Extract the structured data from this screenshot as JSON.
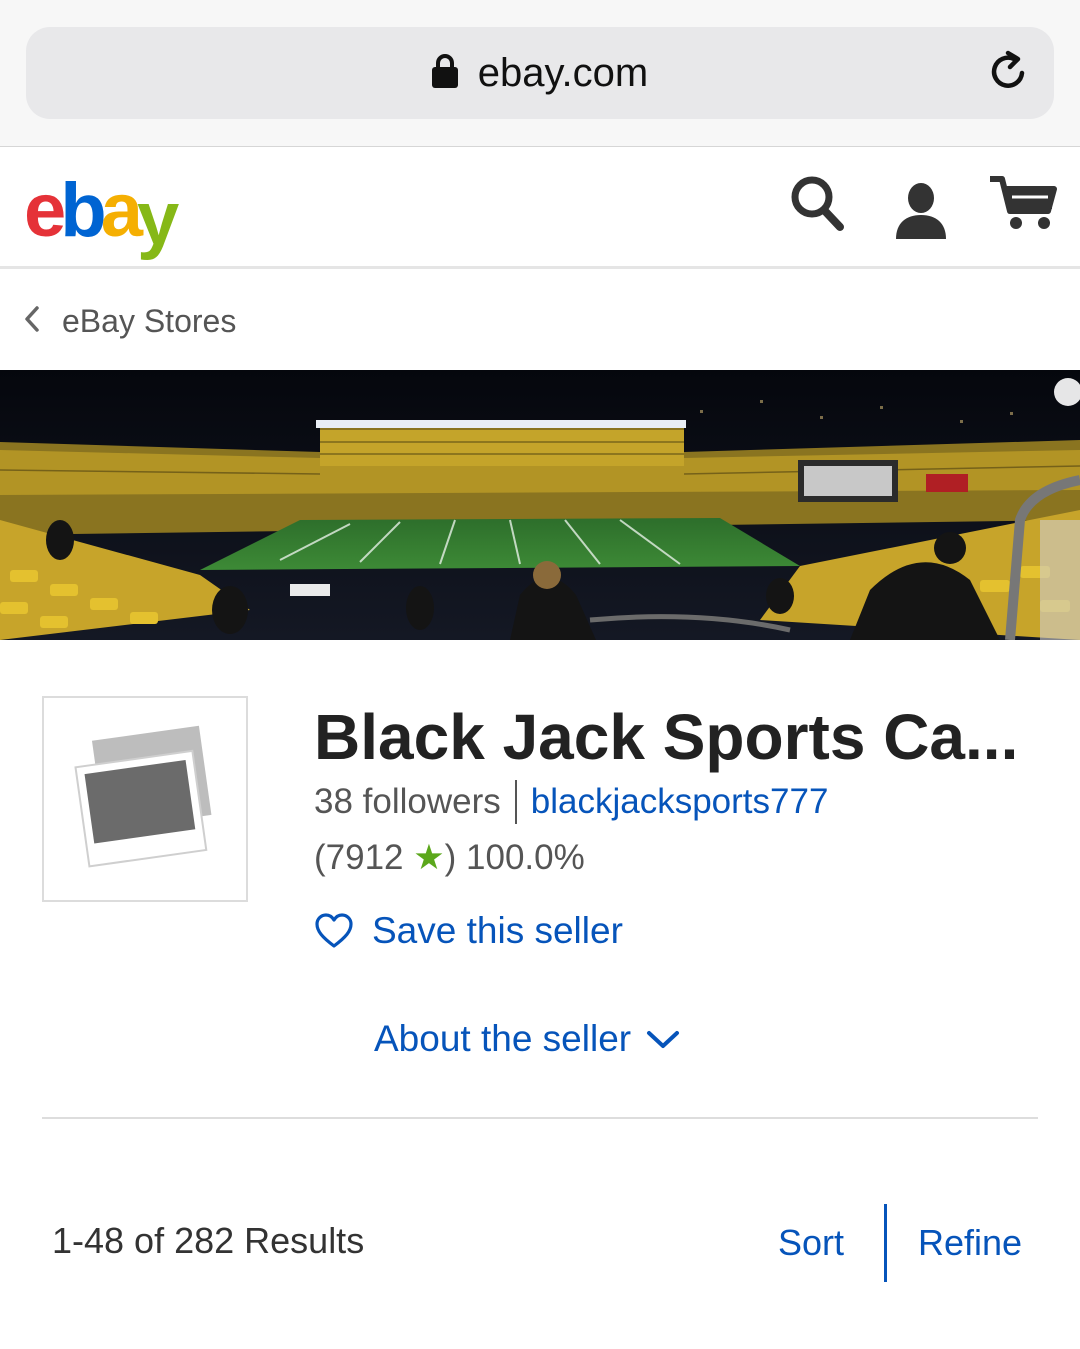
{
  "browser": {
    "url": "ebay.com"
  },
  "ebay_logo": {
    "letters": [
      "e",
      "b",
      "a",
      "y"
    ],
    "colors": [
      "#e53238",
      "#0064d2",
      "#f5af02",
      "#86b817"
    ]
  },
  "header_icons": [
    "search-icon",
    "account-icon",
    "cart-icon"
  ],
  "breadcrumb": {
    "label": "eBay Stores"
  },
  "banner": {
    "description_icon": "stadium-banner-image"
  },
  "store": {
    "name": "Black Jack Sports Ca...",
    "followers": "38 followers",
    "username": "blackjacksports777",
    "rating_prefix": "(7912 ",
    "rating_star": "★",
    "rating_suffix": ") 100.0%",
    "save_label": "Save this seller",
    "about_label": "About the seller"
  },
  "results": {
    "summary": "1-48 of 282 Results",
    "sort_label": "Sort",
    "refine_label": "Refine"
  },
  "colors": {
    "link": "#0654ba",
    "star": "#5ba71b"
  }
}
